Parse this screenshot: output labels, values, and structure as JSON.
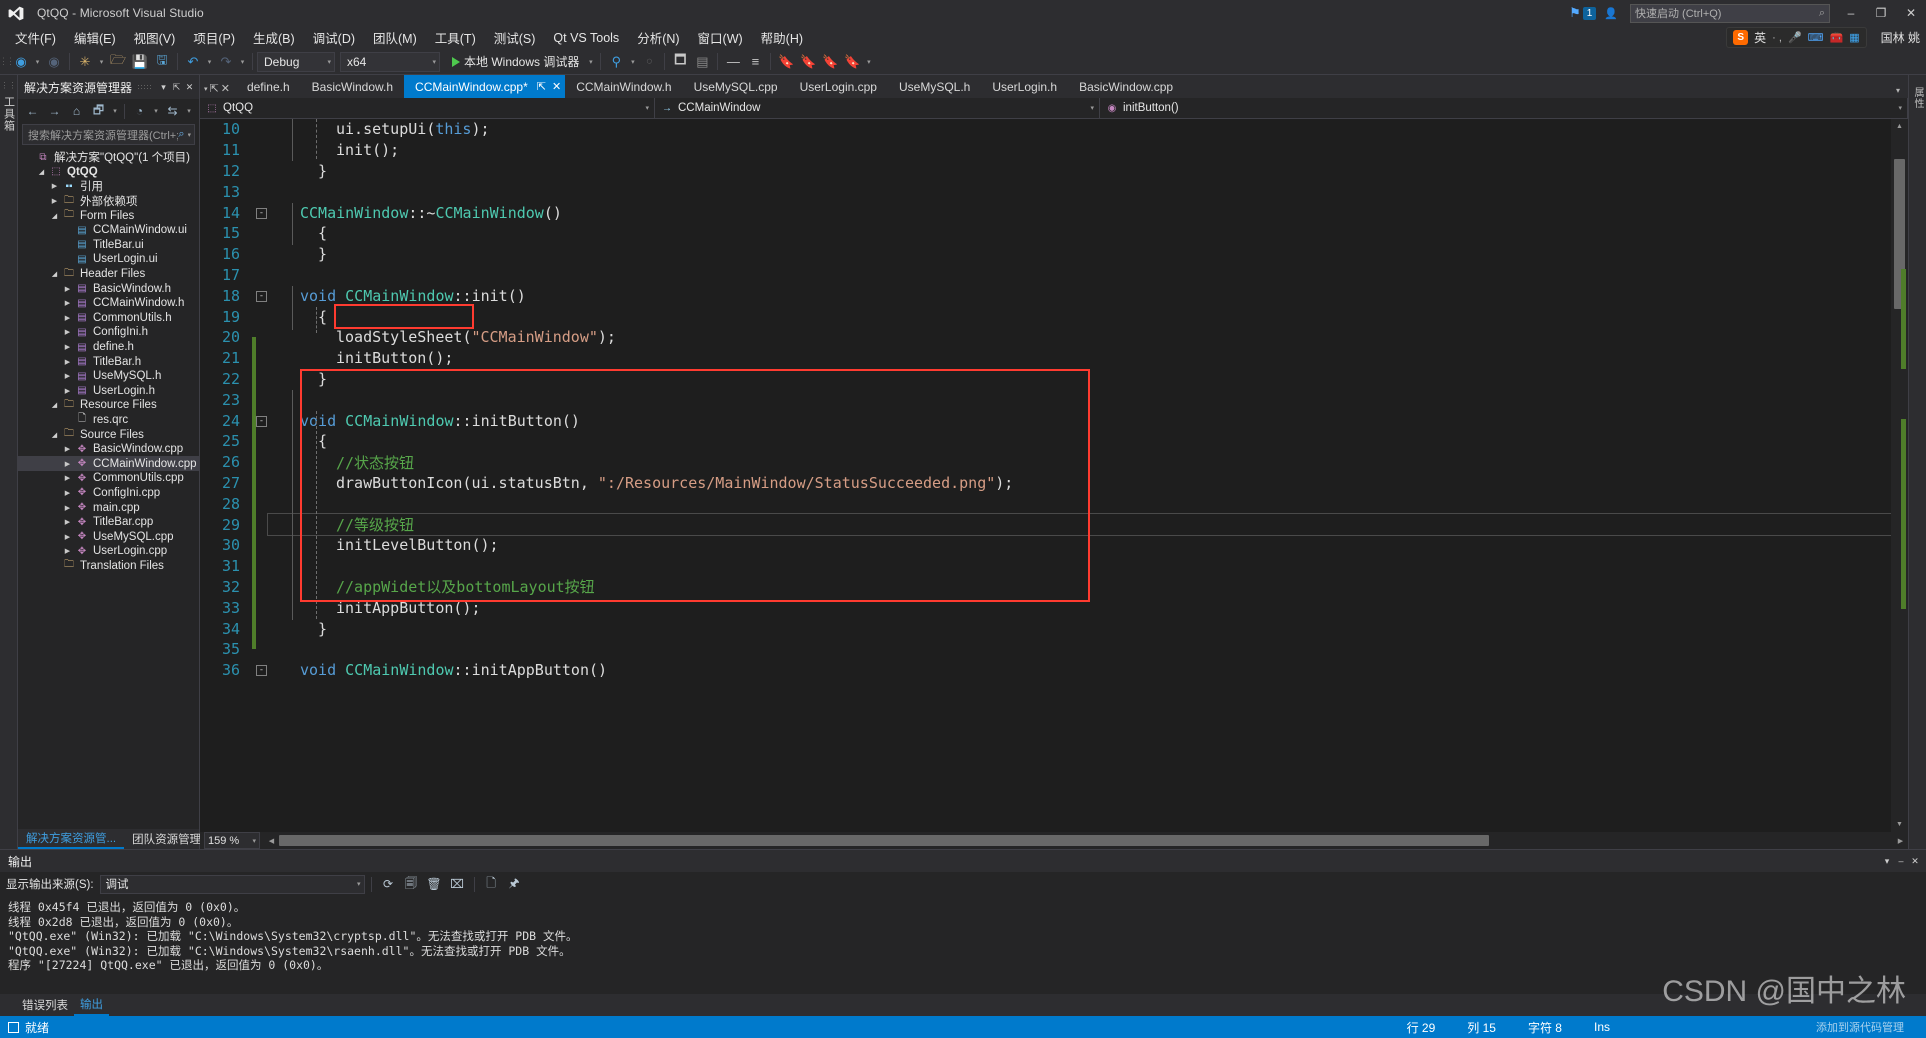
{
  "window": {
    "title": "QtQQ - Microsoft Visual Studio",
    "minimize": "–",
    "maximize": "❐",
    "close": "✕",
    "notification_count": "1",
    "quick_launch_placeholder": "快速启动 (Ctrl+Q)",
    "search_icon": "⌕"
  },
  "menu": {
    "items": [
      "文件(F)",
      "编辑(E)",
      "视图(V)",
      "项目(P)",
      "生成(B)",
      "调试(D)",
      "团队(M)",
      "工具(T)",
      "测试(S)",
      "Qt VS Tools",
      "分析(N)",
      "窗口(W)",
      "帮助(H)"
    ],
    "ime": {
      "logo": "S",
      "mode": "英",
      "dots": "· ,",
      "mic": "🎤",
      "keyboard": "⌨",
      "toolbox": "🧰",
      "apps": "▦"
    },
    "user": "国林 姚"
  },
  "toolbar": {
    "back": "◀",
    "forward": "▶",
    "new_item": "✳",
    "open": "🗂",
    "save": "💾",
    "save_all": "🖫",
    "undo": "↶",
    "redo": "↷",
    "configuration": "Debug",
    "platform": "x64",
    "run_label": "本地 Windows 调试器"
  },
  "sidebar_strip": {
    "label": "工具箱"
  },
  "solution_explorer": {
    "title": "解决方案资源管理器",
    "pin": "⇱",
    "close": "✕",
    "dropdown": "▾",
    "toolbar_icons": [
      "←",
      "→",
      "⌂",
      "🗗",
      "▾",
      "◔",
      "▾",
      "⇆",
      "▾"
    ],
    "search_placeholder": "搜索解决方案资源管理器(Ctrl+;",
    "tree": [
      {
        "depth": 0,
        "arrow": "",
        "icon": "sln",
        "glyph": "⧉",
        "label": "解决方案\"QtQQ\"(1 个项目)",
        "bold": false,
        "selected": false
      },
      {
        "depth": 1,
        "arrow": "open",
        "icon": "proj",
        "glyph": "⬚",
        "label": "QtQQ",
        "bold": true,
        "selected": false
      },
      {
        "depth": 2,
        "arrow": "closed",
        "icon": "ref",
        "glyph": "▪▪",
        "label": "引用",
        "bold": false,
        "selected": false
      },
      {
        "depth": 2,
        "arrow": "closed",
        "icon": "folder",
        "glyph": "🗀",
        "label": "外部依赖项",
        "bold": false,
        "selected": false
      },
      {
        "depth": 2,
        "arrow": "open",
        "icon": "folder",
        "glyph": "🗀",
        "label": "Form Files",
        "bold": false,
        "selected": false
      },
      {
        "depth": 3,
        "arrow": "",
        "icon": "ui",
        "glyph": "▤",
        "label": "CCMainWindow.ui",
        "bold": false,
        "selected": false
      },
      {
        "depth": 3,
        "arrow": "",
        "icon": "ui",
        "glyph": "▤",
        "label": "TitleBar.ui",
        "bold": false,
        "selected": false
      },
      {
        "depth": 3,
        "arrow": "",
        "icon": "ui",
        "glyph": "▤",
        "label": "UserLogin.ui",
        "bold": false,
        "selected": false
      },
      {
        "depth": 2,
        "arrow": "open",
        "icon": "folder",
        "glyph": "🗀",
        "label": "Header Files",
        "bold": false,
        "selected": false
      },
      {
        "depth": 3,
        "arrow": "closed",
        "icon": "h",
        "glyph": "▤",
        "label": "BasicWindow.h",
        "bold": false,
        "selected": false
      },
      {
        "depth": 3,
        "arrow": "closed",
        "icon": "h",
        "glyph": "▤",
        "label": "CCMainWindow.h",
        "bold": false,
        "selected": false
      },
      {
        "depth": 3,
        "arrow": "closed",
        "icon": "h",
        "glyph": "▤",
        "label": "CommonUtils.h",
        "bold": false,
        "selected": false
      },
      {
        "depth": 3,
        "arrow": "closed",
        "icon": "h",
        "glyph": "▤",
        "label": "ConfigIni.h",
        "bold": false,
        "selected": false
      },
      {
        "depth": 3,
        "arrow": "closed",
        "icon": "h",
        "glyph": "▤",
        "label": "define.h",
        "bold": false,
        "selected": false
      },
      {
        "depth": 3,
        "arrow": "closed",
        "icon": "h",
        "glyph": "▤",
        "label": "TitleBar.h",
        "bold": false,
        "selected": false
      },
      {
        "depth": 3,
        "arrow": "closed",
        "icon": "h",
        "glyph": "▤",
        "label": "UseMySQL.h",
        "bold": false,
        "selected": false
      },
      {
        "depth": 3,
        "arrow": "closed",
        "icon": "h",
        "glyph": "▤",
        "label": "UserLogin.h",
        "bold": false,
        "selected": false
      },
      {
        "depth": 2,
        "arrow": "open",
        "icon": "folder",
        "glyph": "🗀",
        "label": "Resource Files",
        "bold": false,
        "selected": false
      },
      {
        "depth": 3,
        "arrow": "",
        "icon": "file",
        "glyph": "🗋",
        "label": "res.qrc",
        "bold": false,
        "selected": false
      },
      {
        "depth": 2,
        "arrow": "open",
        "icon": "folder",
        "glyph": "🗀",
        "label": "Source Files",
        "bold": false,
        "selected": false
      },
      {
        "depth": 3,
        "arrow": "closed",
        "icon": "cpp",
        "glyph": "✥",
        "label": "BasicWindow.cpp",
        "bold": false,
        "selected": false
      },
      {
        "depth": 3,
        "arrow": "closed",
        "icon": "cpp",
        "glyph": "✥",
        "label": "CCMainWindow.cpp",
        "bold": false,
        "selected": true
      },
      {
        "depth": 3,
        "arrow": "closed",
        "icon": "cpp",
        "glyph": "✥",
        "label": "CommonUtils.cpp",
        "bold": false,
        "selected": false
      },
      {
        "depth": 3,
        "arrow": "closed",
        "icon": "cpp",
        "glyph": "✥",
        "label": "ConfigIni.cpp",
        "bold": false,
        "selected": false
      },
      {
        "depth": 3,
        "arrow": "closed",
        "icon": "cpp",
        "glyph": "✥",
        "label": "main.cpp",
        "bold": false,
        "selected": false
      },
      {
        "depth": 3,
        "arrow": "closed",
        "icon": "cpp",
        "glyph": "✥",
        "label": "TitleBar.cpp",
        "bold": false,
        "selected": false
      },
      {
        "depth": 3,
        "arrow": "closed",
        "icon": "cpp",
        "glyph": "✥",
        "label": "UseMySQL.cpp",
        "bold": false,
        "selected": false
      },
      {
        "depth": 3,
        "arrow": "closed",
        "icon": "cpp",
        "glyph": "✥",
        "label": "UserLogin.cpp",
        "bold": false,
        "selected": false
      },
      {
        "depth": 2,
        "arrow": "",
        "icon": "folder",
        "glyph": "🗀",
        "label": "Translation Files",
        "bold": false,
        "selected": false
      }
    ],
    "bottom_tabs": [
      {
        "label": "解决方案资源管...",
        "active": true
      },
      {
        "label": "团队资源管理器",
        "active": false
      }
    ]
  },
  "editor": {
    "tabs": [
      {
        "label": "define.h",
        "active": false
      },
      {
        "label": "BasicWindow.h",
        "active": false
      },
      {
        "label": "CCMainWindow.cpp*",
        "active": true
      },
      {
        "label": "CCMainWindow.h",
        "active": false
      },
      {
        "label": "UseMySQL.cpp",
        "active": false
      },
      {
        "label": "UserLogin.cpp",
        "active": false
      },
      {
        "label": "UseMySQL.h",
        "active": false
      },
      {
        "label": "UserLogin.h",
        "active": false
      },
      {
        "label": "BasicWindow.cpp",
        "active": false
      }
    ],
    "tab_pin": "⇱",
    "tab_close": "✕",
    "navbar": {
      "project": "QtQQ",
      "class": "CCMainWindow",
      "member": "initButton()",
      "class_arrow": "→",
      "member_icon": "◉",
      "caret": "▾"
    },
    "zoom": "159 %",
    "lines": [
      {
        "n": 10,
        "indent": 3,
        "changed": false,
        "tokens": [
          {
            "t": "ui.",
            "c": "pl"
          },
          {
            "t": "setupUi",
            "c": "pl"
          },
          {
            "t": "(",
            "c": "pl"
          },
          {
            "t": "this",
            "c": "kw"
          },
          {
            "t": ");",
            "c": "pl"
          }
        ]
      },
      {
        "n": 11,
        "indent": 3,
        "changed": false,
        "tokens": [
          {
            "t": "init();",
            "c": "pl"
          }
        ]
      },
      {
        "n": 12,
        "indent": 2,
        "changed": false,
        "tokens": [
          {
            "t": "}",
            "c": "pl"
          }
        ]
      },
      {
        "n": 13,
        "indent": 0,
        "changed": false,
        "tokens": []
      },
      {
        "n": 14,
        "indent": 1,
        "changed": false,
        "collapse": true,
        "tokens": [
          {
            "t": "CCMainWindow",
            "c": "ty"
          },
          {
            "t": "::~",
            "c": "pl"
          },
          {
            "t": "CCMainWindow",
            "c": "ty"
          },
          {
            "t": "()",
            "c": "pl"
          }
        ]
      },
      {
        "n": 15,
        "indent": 2,
        "changed": false,
        "tokens": [
          {
            "t": "{",
            "c": "pl"
          }
        ]
      },
      {
        "n": 16,
        "indent": 2,
        "changed": false,
        "tokens": [
          {
            "t": "}",
            "c": "pl"
          }
        ]
      },
      {
        "n": 17,
        "indent": 0,
        "changed": false,
        "tokens": []
      },
      {
        "n": 18,
        "indent": 1,
        "changed": false,
        "collapse": true,
        "tokens": [
          {
            "t": "void ",
            "c": "kw"
          },
          {
            "t": "CCMainWindow",
            "c": "ty"
          },
          {
            "t": "::init()",
            "c": "pl"
          }
        ]
      },
      {
        "n": 19,
        "indent": 2,
        "changed": false,
        "tokens": [
          {
            "t": "{",
            "c": "pl"
          }
        ]
      },
      {
        "n": 20,
        "indent": 3,
        "changed": true,
        "tokens": [
          {
            "t": "loadStyleSheet",
            "c": "pl"
          },
          {
            "t": "(",
            "c": "pl"
          },
          {
            "t": "\"CCMainWindow\"",
            "c": "str"
          },
          {
            "t": ");",
            "c": "pl"
          }
        ]
      },
      {
        "n": 21,
        "indent": 3,
        "changed": true,
        "tokens": [
          {
            "t": "initButton();",
            "c": "pl"
          }
        ]
      },
      {
        "n": 22,
        "indent": 2,
        "changed": true,
        "tokens": [
          {
            "t": "}",
            "c": "pl"
          }
        ]
      },
      {
        "n": 23,
        "indent": 0,
        "changed": true,
        "tokens": []
      },
      {
        "n": 24,
        "indent": 1,
        "changed": true,
        "collapse": true,
        "tokens": [
          {
            "t": "void ",
            "c": "kw"
          },
          {
            "t": "CCMainWindow",
            "c": "ty"
          },
          {
            "t": "::initButton()",
            "c": "pl"
          }
        ]
      },
      {
        "n": 25,
        "indent": 2,
        "changed": true,
        "tokens": [
          {
            "t": "{",
            "c": "pl"
          }
        ]
      },
      {
        "n": 26,
        "indent": 3,
        "changed": true,
        "tokens": [
          {
            "t": "//状态按钮",
            "c": "cm"
          }
        ]
      },
      {
        "n": 27,
        "indent": 3,
        "changed": true,
        "tokens": [
          {
            "t": "drawButtonIcon",
            "c": "pl"
          },
          {
            "t": "(ui.statusBtn, ",
            "c": "pl"
          },
          {
            "t": "\":/Resources/MainWindow/StatusSucceeded.png\"",
            "c": "str"
          },
          {
            "t": ");",
            "c": "pl"
          }
        ]
      },
      {
        "n": 28,
        "indent": 0,
        "changed": true,
        "tokens": []
      },
      {
        "n": 29,
        "indent": 3,
        "changed": true,
        "current": true,
        "tokens": [
          {
            "t": "//等级按钮",
            "c": "cm"
          }
        ]
      },
      {
        "n": 30,
        "indent": 3,
        "changed": true,
        "tokens": [
          {
            "t": "initLevelButton();",
            "c": "pl"
          }
        ]
      },
      {
        "n": 31,
        "indent": 0,
        "changed": true,
        "tokens": []
      },
      {
        "n": 32,
        "indent": 3,
        "changed": true,
        "tokens": [
          {
            "t": "//appWidet以及bottomLayout按钮",
            "c": "cm"
          }
        ]
      },
      {
        "n": 33,
        "indent": 3,
        "changed": true,
        "tokens": [
          {
            "t": "initAppButton();",
            "c": "pl"
          }
        ]
      },
      {
        "n": 34,
        "indent": 2,
        "changed": true,
        "tokens": [
          {
            "t": "}",
            "c": "pl"
          }
        ]
      },
      {
        "n": 35,
        "indent": 0,
        "changed": false,
        "tokens": []
      },
      {
        "n": 36,
        "indent": 1,
        "changed": false,
        "collapse": true,
        "tokens": [
          {
            "t": "void ",
            "c": "kw"
          },
          {
            "t": "CCMainWindow",
            "c": "ty"
          },
          {
            "t": "::initAppButton()",
            "c": "pl"
          }
        ]
      }
    ]
  },
  "output_panel": {
    "title": "输出",
    "dropdown": "▾",
    "minimize": "–",
    "close": "✕",
    "source_label": "显示输出来源(S):",
    "source_value": "调试",
    "toolbar_icons": [
      "⟳",
      "🗐",
      "🗑",
      "⌧",
      "🗋",
      "🖈"
    ],
    "lines": [
      "线程 0x45f4 已退出，返回值为 0 (0x0)。",
      "线程 0x2d8 已退出，返回值为 0 (0x0)。",
      "\"QtQQ.exe\" (Win32): 已加载 \"C:\\Windows\\System32\\cryptsp.dll\"。无法查找或打开 PDB 文件。",
      "\"QtQQ.exe\" (Win32): 已加载 \"C:\\Windows\\System32\\rsaenh.dll\"。无法查找或打开 PDB 文件。",
      "程序 \"[27224] QtQQ.exe\" 已退出，返回值为 0 (0x0)。"
    ]
  },
  "bottom_tabs": [
    {
      "label": "错误列表",
      "active": false
    },
    {
      "label": "输出",
      "active": true
    }
  ],
  "status_bar": {
    "ready": "就绪",
    "line_label": "行 29",
    "col_label": "列 15",
    "char_label": "字符 8",
    "ins_label": "Ins"
  },
  "watermark": {
    "main": "CSDN @国中之林",
    "sub": "添加到源代码管理"
  },
  "colors": {
    "accent": "#007acc",
    "highlight_box": "#ff3b30",
    "changed_bar": "#4f7d2a",
    "keyword": "#569cd6",
    "type": "#4ec9b0",
    "comment": "#57a64a",
    "string": "#d69d85",
    "linenum": "#2b91af"
  }
}
